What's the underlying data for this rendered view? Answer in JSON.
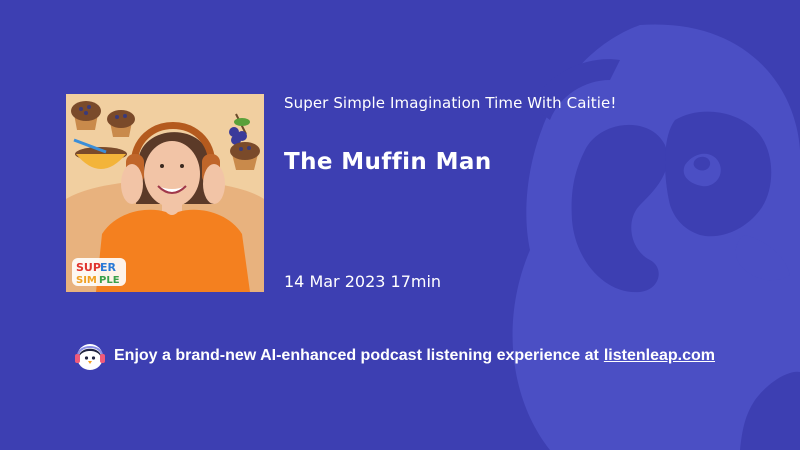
{
  "podcast": {
    "show_title": "Super Simple Imagination Time With Caitie!",
    "episode_title": "The Muffin Man",
    "date": "14 Mar 2023",
    "duration": "17min",
    "cover_logo_text": "Super Simple"
  },
  "promo": {
    "text": "Enjoy a brand-new AI-enhanced podcast listening experience at",
    "link_text": "listenleap.com"
  },
  "icons": {
    "cover": "podcast-cover-image",
    "promo": "penguin-headphones-icon",
    "background": "penguin-mascot-watermark"
  },
  "colors": {
    "background": "#3d3fb2",
    "watermark": "#4b4fc4",
    "text": "#ffffff"
  }
}
